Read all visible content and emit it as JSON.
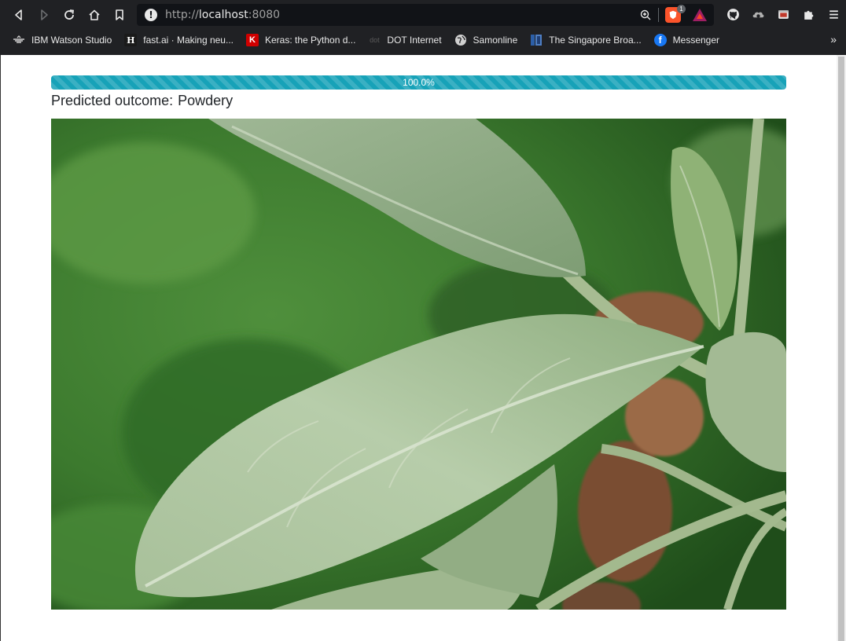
{
  "browser": {
    "url_scheme": "http://",
    "url_host": "localhost",
    "url_port": ":8080",
    "brave_shield_count": "1",
    "bookmarks": [
      {
        "label": "IBM Watson Studio",
        "icon": "ibm-icon"
      },
      {
        "label": "fast.ai · Making neu...",
        "icon": "fastai-icon",
        "glyph": "H"
      },
      {
        "label": "Keras: the Python d...",
        "icon": "keras-icon",
        "glyph": "K"
      },
      {
        "label": "DOT Internet",
        "icon": "dot-icon",
        "glyph": "dot"
      },
      {
        "label": "Samonline",
        "icon": "globe-icon"
      },
      {
        "label": "The Singapore Broa...",
        "icon": "bookmark-favicon"
      },
      {
        "label": "Messenger",
        "icon": "facebook-icon",
        "glyph": "f"
      }
    ],
    "more_bookmarks": "»"
  },
  "page": {
    "progress": {
      "label": "100.0%",
      "percent": 100
    },
    "outcome_label": "Predicted outcome:",
    "outcome_value": "Powdery"
  },
  "colors": {
    "chrome_bg": "#202124",
    "progress_fill": "#17a2b8",
    "text": "#212529"
  }
}
